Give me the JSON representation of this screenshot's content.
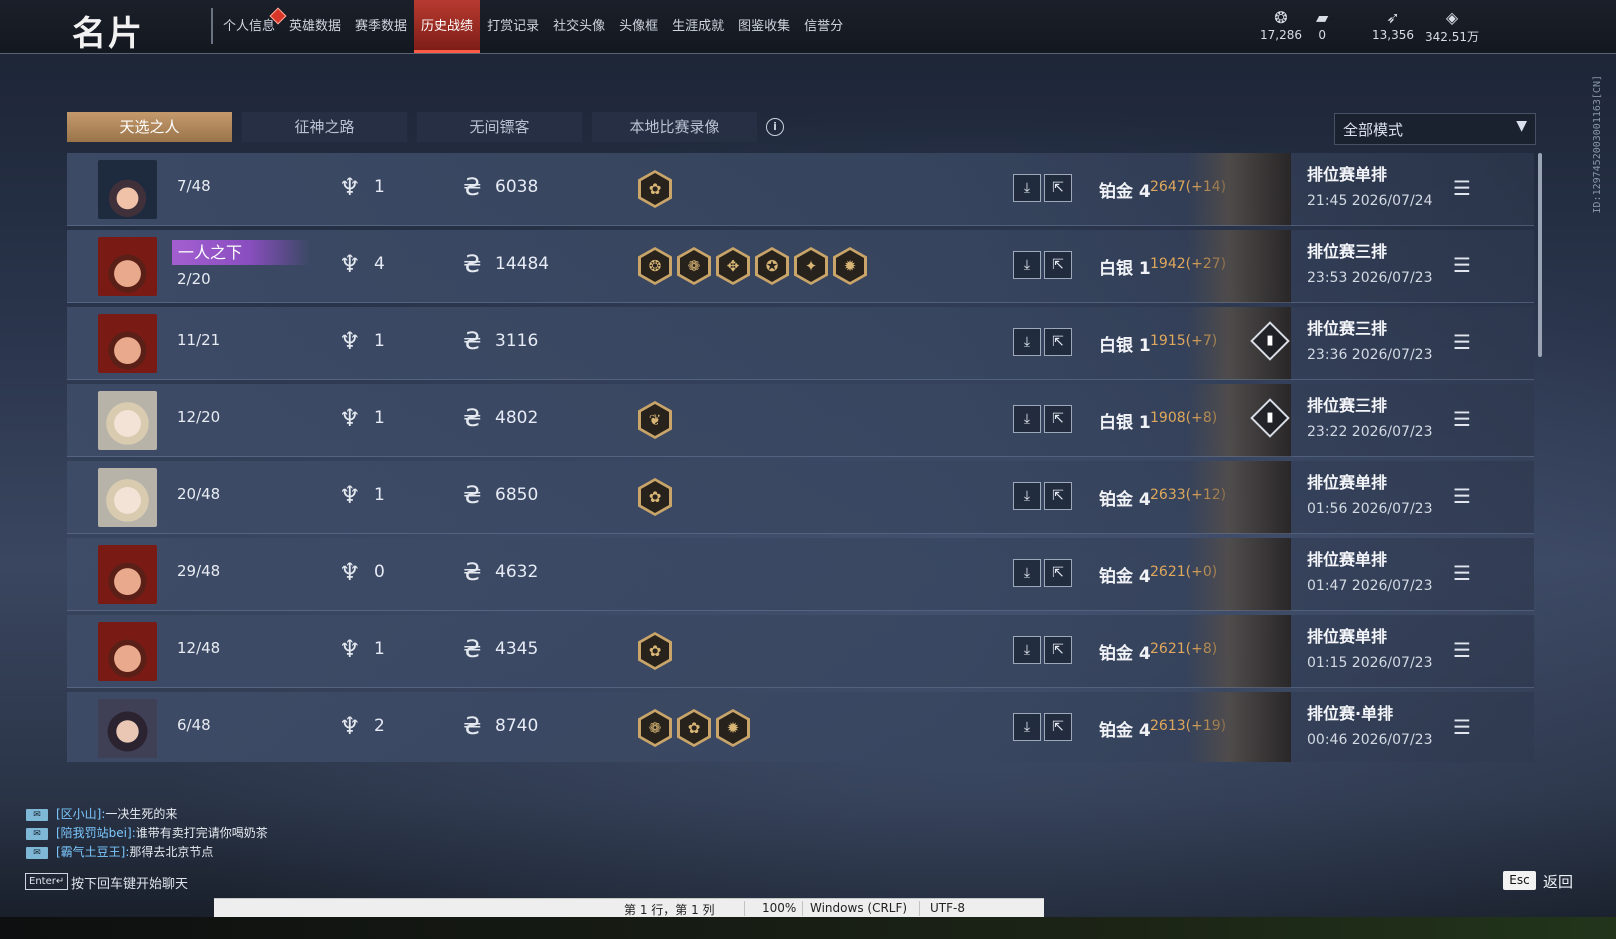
{
  "header": {
    "title": "名片",
    "nav": [
      "个人信息",
      "英雄数据",
      "赛季数据",
      "历史战绩",
      "打赏记录",
      "社交头像",
      "头像框",
      "生涯成就",
      "图鉴收集",
      "信誉分"
    ],
    "active_nav": "历史战绩",
    "currencies": [
      {
        "icon": "gem-icon",
        "value": "17,286"
      },
      {
        "icon": "ticket-icon",
        "value": "0"
      },
      {
        "icon": "feather-icon",
        "value": "13,356"
      },
      {
        "icon": "diamond-icon",
        "value": "342.51万"
      }
    ],
    "side_id": "ID:1297452003001163[CN]"
  },
  "tabs": [
    "天选之人",
    "征神之路",
    "无间镖客",
    "本地比赛录像"
  ],
  "mode_select": {
    "value": "全部模式"
  },
  "rows": [
    {
      "portrait": "witch",
      "rank": "7/48",
      "tag": "",
      "kills": "1",
      "coins": "6038",
      "traits": [
        "✿"
      ],
      "tier": "铂金 4",
      "score": "2647(+14)",
      "stat": false,
      "mode": "排位赛单排",
      "time": "21:45  2026/07/24"
    },
    {
      "portrait": "red",
      "rank": "2/20",
      "tag": "一人之下",
      "kills": "4",
      "coins": "14484",
      "traits": [
        "❂",
        "❁",
        "✥",
        "✪",
        "✦",
        "✹"
      ],
      "tier": "白银 1",
      "score": "1942(+27)",
      "stat": false,
      "mode": "排位赛三排",
      "time": "23:53  2026/07/23"
    },
    {
      "portrait": "red",
      "rank": "11/21",
      "tag": "",
      "kills": "1",
      "coins": "3116",
      "traits": [],
      "tier": "白银 1",
      "score": "1915(+7)",
      "stat": true,
      "mode": "排位赛三排",
      "time": "23:36  2026/07/23"
    },
    {
      "portrait": "white",
      "rank": "12/20",
      "tag": "",
      "kills": "1",
      "coins": "4802",
      "traits": [
        "❦"
      ],
      "tier": "白银 1",
      "score": "1908(+8)",
      "stat": true,
      "mode": "排位赛三排",
      "time": "23:22  2026/07/23"
    },
    {
      "portrait": "white",
      "rank": "20/48",
      "tag": "",
      "kills": "1",
      "coins": "6850",
      "traits": [
        "✿"
      ],
      "tier": "铂金 4",
      "score": "2633(+12)",
      "stat": false,
      "mode": "排位赛单排",
      "time": "01:56  2026/07/23"
    },
    {
      "portrait": "red",
      "rank": "29/48",
      "tag": "",
      "kills": "0",
      "coins": "4632",
      "traits": [],
      "tier": "铂金 4",
      "score": "2621(+0)",
      "stat": false,
      "mode": "排位赛单排",
      "time": "01:47  2026/07/23"
    },
    {
      "portrait": "red",
      "rank": "12/48",
      "tag": "",
      "kills": "1",
      "coins": "4345",
      "traits": [
        "✿"
      ],
      "tier": "铂金 4",
      "score": "2621(+8)",
      "stat": false,
      "mode": "排位赛单排",
      "time": "01:15  2026/07/23"
    },
    {
      "portrait": "dark",
      "rank": "6/48",
      "tag": "",
      "kills": "2",
      "coins": "8740",
      "traits": [
        "❁",
        "✿",
        "✹"
      ],
      "tier": "铂金 4",
      "score": "2613(+19)",
      "stat": false,
      "mode": "排位赛·单排",
      "time": "00:46  2026/07/23"
    }
  ],
  "chat": [
    {
      "name": "[区小山]:",
      "msg": "一决生死的来"
    },
    {
      "name": "[陪我罚站bei]:",
      "msg": "谁带有卖打完请你喝奶茶"
    },
    {
      "name": "[霸气土豆王]:",
      "msg": "那得去北京节点"
    }
  ],
  "chat_hint": {
    "key": "Enter↵",
    "text": "按下回车键开始聊天"
  },
  "esc": {
    "key": "Esc",
    "label": "返回"
  },
  "statusbar": {
    "position": "第 1 行，第 1 列",
    "zoom": "100%",
    "eol": "Windows (CRLF)",
    "encoding": "UTF-8"
  }
}
